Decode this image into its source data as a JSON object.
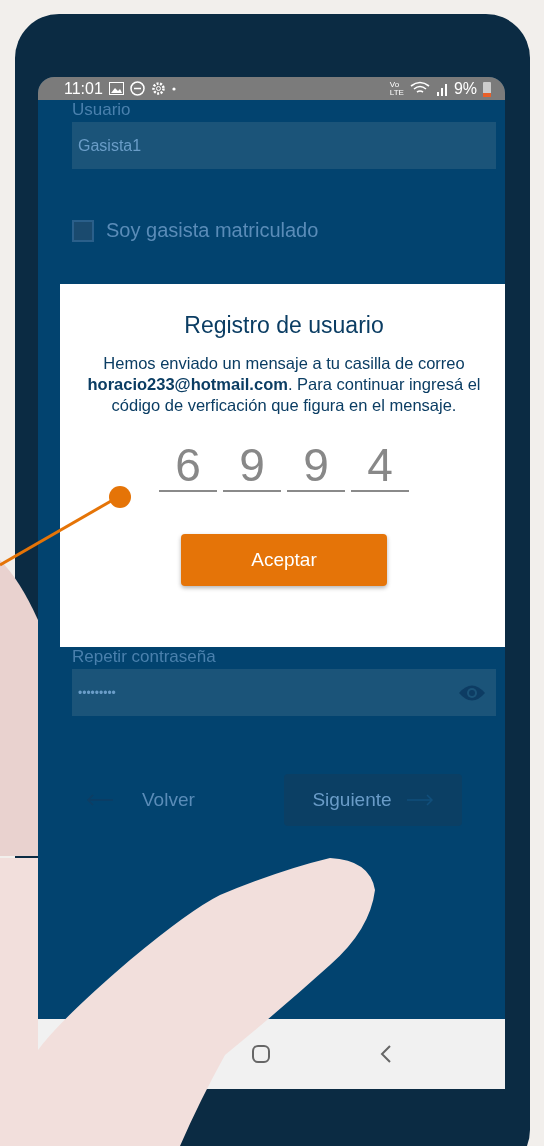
{
  "status_bar": {
    "time": "11:01",
    "network_label": [
      "Vo",
      "LTE"
    ],
    "battery": "9%"
  },
  "form": {
    "user_label": "Usuario",
    "user_value": "Gasista1",
    "checkbox": {
      "label": "Soy gasista matriculado",
      "checked": false
    },
    "repeat_label": "Repetir contraseña",
    "repeat_value": "•••••••••",
    "back_button": "Volver",
    "next_button": "Siguiente"
  },
  "dialog": {
    "title": "Registro de usuario",
    "message": "Hemos enviado un mensaje a tu casilla de correo **horacio233@hotmail.com**. Para continuar ingresá el código de verficación que figura en el mensaje.",
    "code_digits": [
      "6",
      "9",
      "9",
      "4"
    ],
    "accept_button": "Aceptar"
  }
}
